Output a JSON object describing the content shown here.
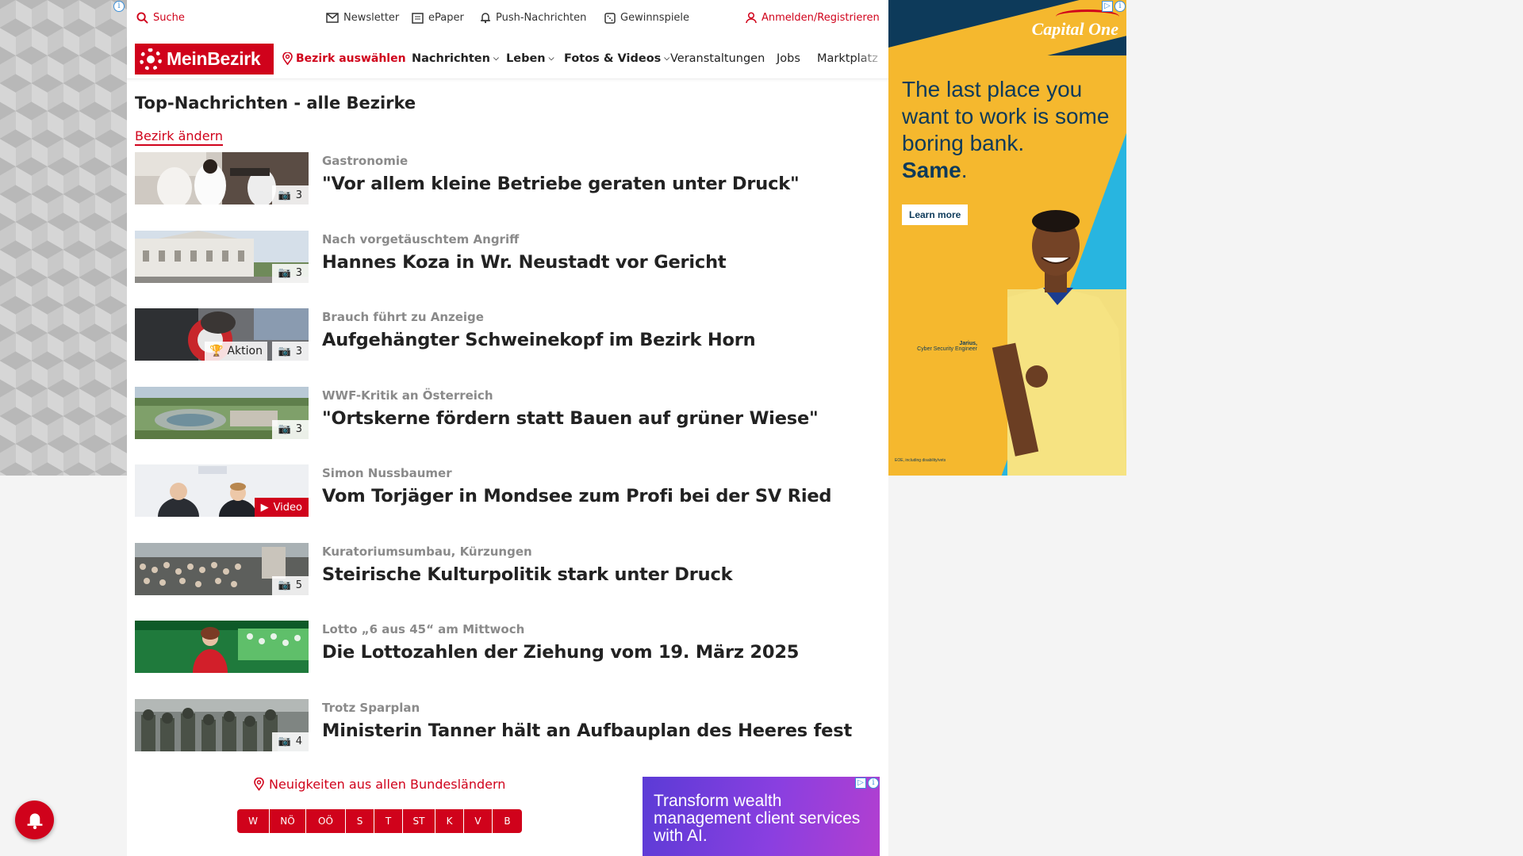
{
  "topbar": {
    "search": "Suche",
    "newsletter": "Newsletter",
    "epaper": "ePaper",
    "push": "Push-Nachrichten",
    "gewinnspiele": "Gewinnspiele",
    "login": "Anmelden/Registrieren"
  },
  "nav": {
    "logo": "MeinBezirk",
    "bezirk": "Bezirk auswählen",
    "items": [
      "Nachrichten",
      "Leben",
      "Fotos & Videos",
      "Veranstaltungen",
      "Jobs",
      "Marktplatz"
    ]
  },
  "page": {
    "title": "Top-Nachrichten - alle Bezirke",
    "change": "Bezirk ändern"
  },
  "articles": [
    {
      "kicker": "Gastronomie",
      "headline": "\"Vor allem kleine Betriebe geraten unter Druck\"",
      "badge": "3"
    },
    {
      "kicker": "Nach vorgetäuschtem Angriff",
      "headline": "Hannes Koza in Wr. Neustadt vor Gericht",
      "badge": "3"
    },
    {
      "kicker": "Brauch führt zu Anzeige",
      "headline": "Aufgehängter Schweinekopf im Bezirk Horn",
      "badge": "3",
      "aktion": "Aktion"
    },
    {
      "kicker": "WWF-Kritik an Österreich",
      "headline": "\"Ortskerne fördern statt Bauen auf grüner Wiese\"",
      "badge": "3"
    },
    {
      "kicker": "Simon Nussbaumer",
      "headline": "Vom Torjäger in Mondsee zum Profi bei der SV Ried",
      "badge": "Video"
    },
    {
      "kicker": "Kuratoriumsumbau, Kürzungen",
      "headline": "Steirische Kulturpolitik stark unter Druck",
      "badge": "5"
    },
    {
      "kicker": "Lotto „6 aus 45“ am Mittwoch",
      "headline": "Die Lottozahlen der Ziehung vom 19. März 2025",
      "badge": ""
    },
    {
      "kicker": "Trotz Sparplan",
      "headline": "Ministerin Tanner hält an Aufbauplan des Heeres fest",
      "badge": "4"
    }
  ],
  "states": {
    "link": "Neuigkeiten aus allen Bundesländern",
    "buttons": [
      "W",
      "NÖ",
      "OÖ",
      "S",
      "T",
      "ST",
      "K",
      "V",
      "B"
    ]
  },
  "promo": {
    "text": "Transform wealth management client services with AI."
  },
  "ad": {
    "brand": "Capital One",
    "line1": "The last place you want to work is some boring bank.",
    "line2": "Same",
    "line2_suffix": ".",
    "button": "Learn more",
    "caption_name": "Jarius,",
    "caption_role": "Cyber Security Engineer",
    "fineprint": "EOE, including disability/vets"
  },
  "colors": {
    "brand_red": "#d0021b",
    "ad_navy": "#0d3a5a",
    "ad_yellow": "#f5b82e",
    "ad_blue": "#28b5e0"
  }
}
